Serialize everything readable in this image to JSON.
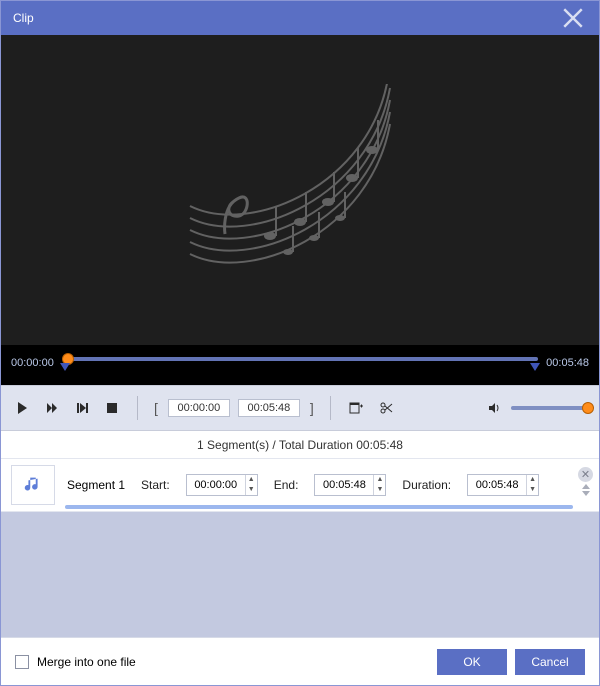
{
  "window": {
    "title": "Clip"
  },
  "timeline": {
    "start": "00:00:00",
    "end": "00:05:48"
  },
  "range": {
    "in": "00:00:00",
    "out": "00:05:48"
  },
  "summary": "1 Segment(s) / Total Duration 00:05:48",
  "segment": {
    "name": "Segment 1",
    "start_label": "Start:",
    "end_label": "End:",
    "duration_label": "Duration:",
    "start": "00:00:00",
    "end": "00:05:48",
    "duration": "00:05:48"
  },
  "footer": {
    "merge_label": "Merge into one file",
    "ok": "OK",
    "cancel": "Cancel"
  }
}
